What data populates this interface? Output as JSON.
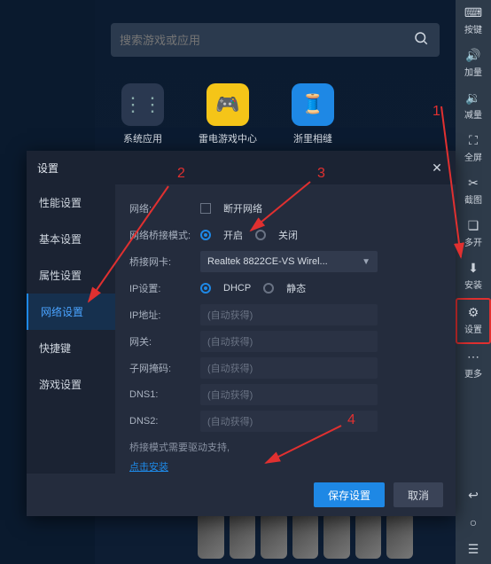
{
  "desktop": {
    "search_placeholder": "搜索游戏或应用",
    "apps": [
      {
        "label": "系统应用"
      },
      {
        "label": "雷电游戏中心"
      },
      {
        "label": "浙里相缝"
      }
    ]
  },
  "rail": {
    "items": [
      {
        "label": "按键"
      },
      {
        "label": "加量"
      },
      {
        "label": "减量"
      },
      {
        "label": "全屏"
      },
      {
        "label": "截图"
      },
      {
        "label": "多开"
      },
      {
        "label": "安装"
      },
      {
        "label": "设置"
      },
      {
        "label": "更多"
      }
    ]
  },
  "settings": {
    "title": "设置",
    "categories": [
      "性能设置",
      "基本设置",
      "属性设置",
      "网络设置",
      "快捷键",
      "游戏设置"
    ],
    "active_index": 3,
    "network": {
      "label": "网络:",
      "disconnect_label": "断开网络"
    },
    "bridge_mode": {
      "label": "网络桥接模式:",
      "on": "开启",
      "off": "关闭"
    },
    "nic": {
      "label": "桥接网卡:",
      "value": "Realtek 8822CE-VS Wirel..."
    },
    "ip_setting": {
      "label": "IP设置:",
      "dhcp": "DHCP",
      "static": "静态"
    },
    "ip_addr": {
      "label": "IP地址:",
      "placeholder": "(自动获得)"
    },
    "gateway": {
      "label": "网关:",
      "placeholder": "(自动获得)"
    },
    "subnet": {
      "label": "子网掩码:",
      "placeholder": "(自动获得)"
    },
    "dns1": {
      "label": "DNS1:",
      "placeholder": "(自动获得)"
    },
    "dns2": {
      "label": "DNS2:",
      "placeholder": "(自动获得)"
    },
    "hint": "桥接模式需要驱动支持,",
    "install_link": "点击安装",
    "buttons": {
      "save": "保存设置",
      "cancel": "取消"
    }
  },
  "annotations": {
    "n1": "1",
    "n2": "2",
    "n3": "3",
    "n4": "4"
  }
}
